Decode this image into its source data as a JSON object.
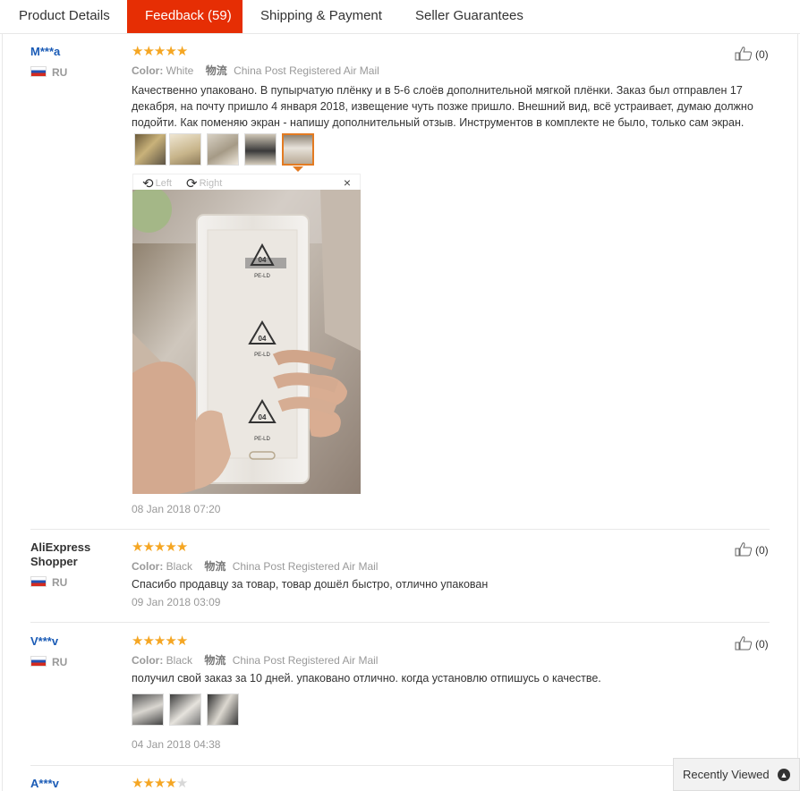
{
  "tabs": [
    {
      "label": "Product Details"
    },
    {
      "label": "Feedback (59)"
    },
    {
      "label": "Shipping & Payment"
    },
    {
      "label": "Seller Guarantees"
    }
  ],
  "color_label": "Color:",
  "shipping_icon_text": "物流",
  "viewer": {
    "left_label": "Left",
    "right_label": "Right",
    "close": "×"
  },
  "reviews": [
    {
      "user": "M***a",
      "country": "RU",
      "rating": 5,
      "color": "White",
      "shipping": "China Post Registered Air Mail",
      "text": "Качественно упаковано. В пупырчатую плёнку и в 5-6 слоёв дополнительной мягкой плёнки. Заказ был отправлен 17 декабря, на почту пришло 4 января 2018, извещение чуть позже пришло. Внешний вид, всё устраивает, думаю должно подойти. Как поменяю экран - напишу дополнительный отзыв. Инструментов в комплекте не было, только сам экран.",
      "date": "08 Jan 2018 07:20",
      "helpful": "(0)"
    },
    {
      "user": "AliExpress Shopper",
      "country": "RU",
      "rating": 5,
      "color": "Black",
      "shipping": "China Post Registered Air Mail",
      "text": "Спасибо продавцу за товар, товар дошёл быстро, отлично упакован",
      "date": "09 Jan 2018 03:09",
      "helpful": "(0)"
    },
    {
      "user": "V***v",
      "country": "RU",
      "rating": 5,
      "color": "Black",
      "shipping": "China Post Registered Air Mail",
      "text": "получил свой заказ за 10 дней. упаковано отлично. когда установлю отпишусь о качестве.",
      "date": "04 Jan 2018 04:38",
      "helpful": "(0)"
    },
    {
      "user": "A***v",
      "rating": 4
    }
  ],
  "recently_viewed": "Recently Viewed",
  "colors": {
    "accent": "#e62e04",
    "star": "#f5a623",
    "link": "#1a5bb6",
    "selected_thumb": "#e37b22"
  }
}
